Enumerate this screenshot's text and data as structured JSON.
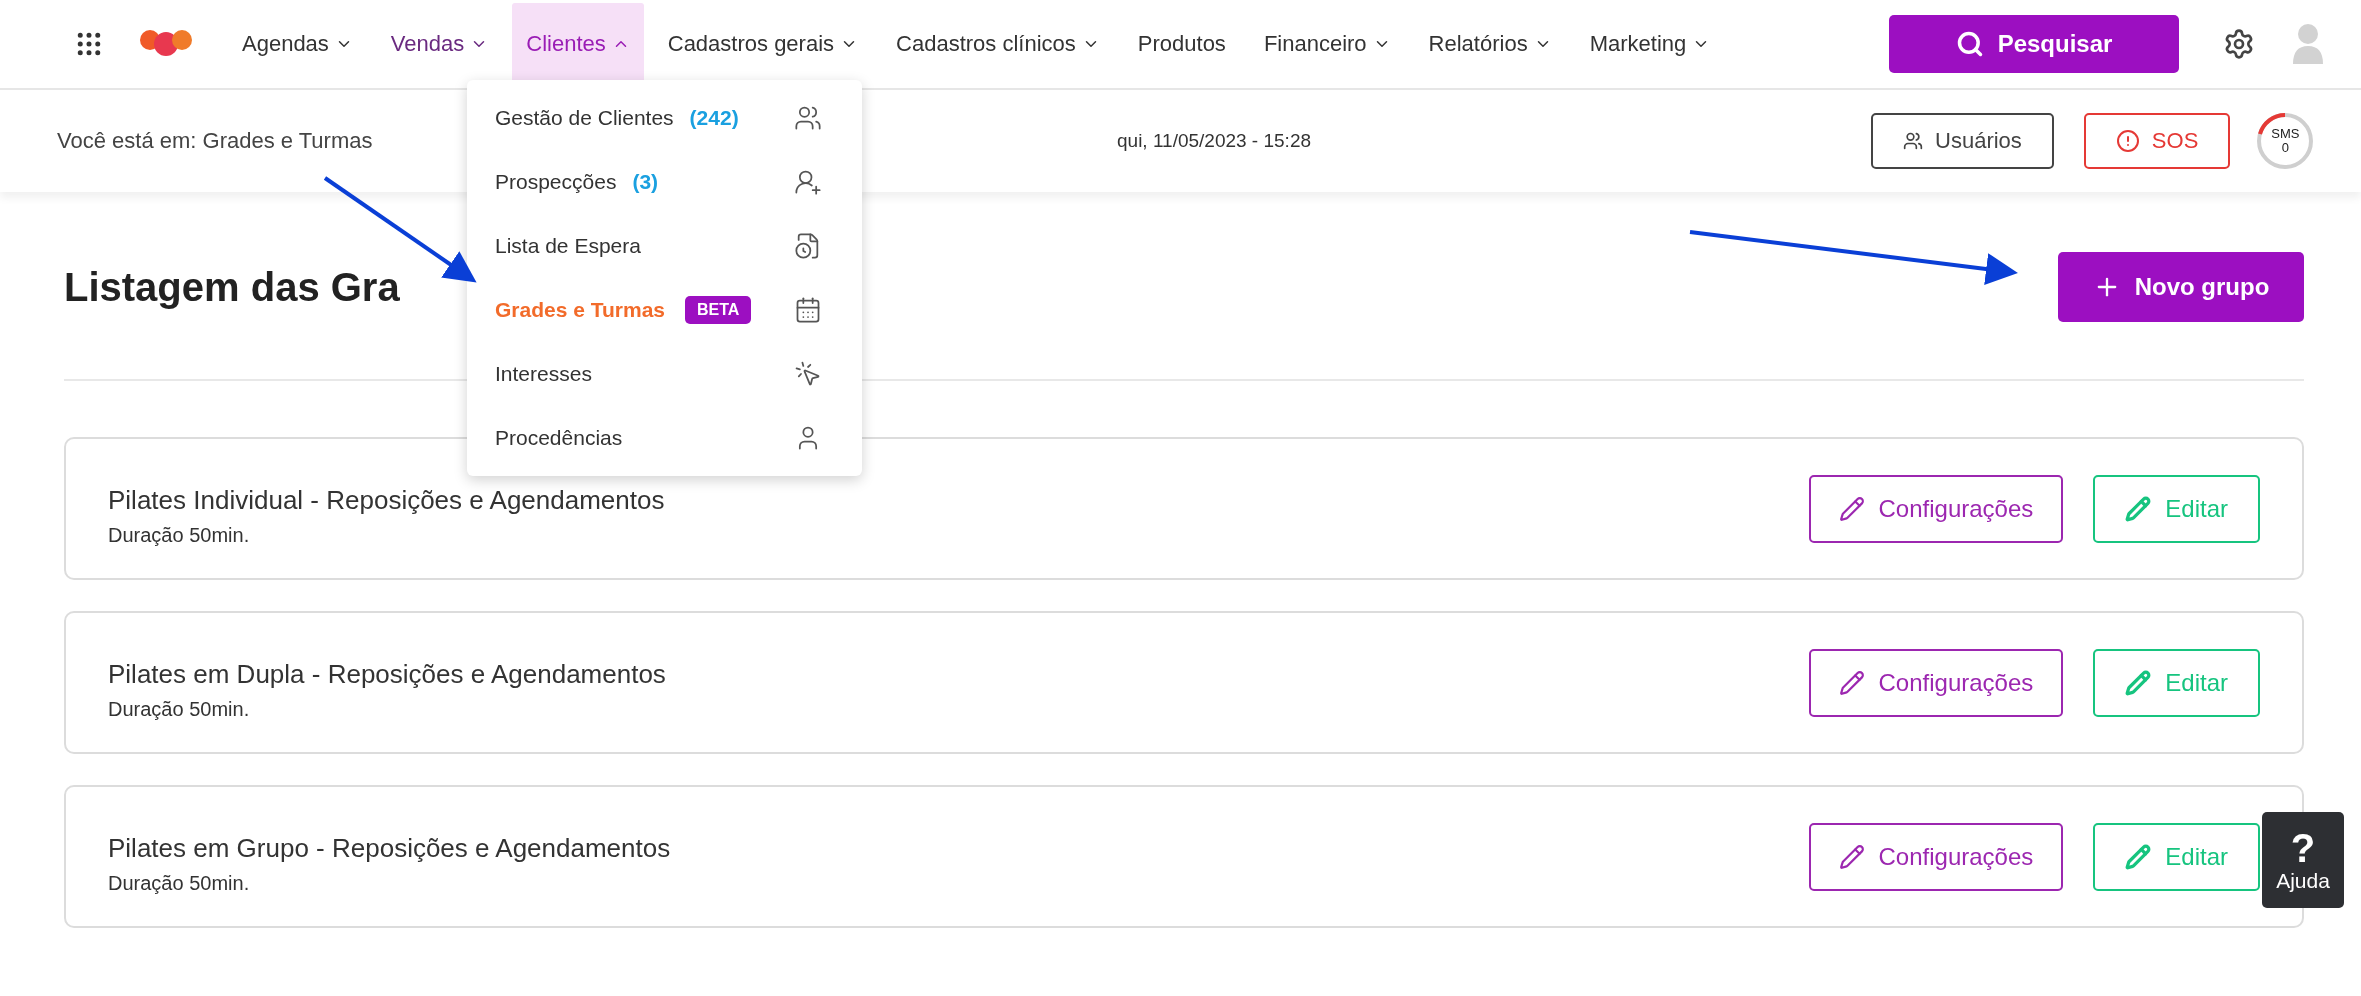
{
  "nav": {
    "items": [
      {
        "label": "Agendas",
        "has_menu": true,
        "accent": false,
        "selected": false
      },
      {
        "label": "Vendas",
        "has_menu": true,
        "accent": true,
        "selected": false
      },
      {
        "label": "Clientes",
        "has_menu": true,
        "accent": true,
        "selected": true
      },
      {
        "label": "Cadastros gerais",
        "has_menu": true,
        "accent": false,
        "selected": false
      },
      {
        "label": "Cadastros clínicos",
        "has_menu": true,
        "accent": false,
        "selected": false
      },
      {
        "label": "Produtos",
        "has_menu": false,
        "accent": false,
        "selected": false
      },
      {
        "label": "Financeiro",
        "has_menu": true,
        "accent": false,
        "selected": false
      },
      {
        "label": "Relatórios",
        "has_menu": true,
        "accent": false,
        "selected": false
      },
      {
        "label": "Marketing",
        "has_menu": true,
        "accent": false,
        "selected": false
      }
    ]
  },
  "search_button": "Pesquisar",
  "breadcrumb": "Você está em: Grades e Turmas",
  "datetime": "qui, 11/05/2023 - 15:28",
  "users_button": "Usuários",
  "sos_button": "SOS",
  "sms": {
    "label": "SMS",
    "count": "0"
  },
  "menu": {
    "items": [
      {
        "label": "Gestão de Clientes",
        "count": "(242)",
        "selected": false
      },
      {
        "label": "Prospecções",
        "count": "(3)",
        "selected": false
      },
      {
        "label": "Lista de Espera",
        "selected": false
      },
      {
        "label": "Grades e Turmas",
        "badge": "BETA",
        "selected": true
      },
      {
        "label": "Interesses",
        "selected": false
      },
      {
        "label": "Procedências",
        "selected": false
      }
    ]
  },
  "page": {
    "title": "Listagem das Gra",
    "new_button": "Novo grupo"
  },
  "groups": [
    {
      "name": "Pilates Individual - Reposições e Agendamentos",
      "duration": "Duração 50min.",
      "settings_button": "Configurações",
      "edit_button": "Editar"
    },
    {
      "name": "Pilates em Dupla - Reposições e Agendamentos",
      "duration": "Duração 50min.",
      "settings_button": "Configurações",
      "edit_button": "Editar"
    },
    {
      "name": "Pilates em Grupo - Reposições e Agendamentos",
      "duration": "Duração 50min.",
      "settings_button": "Configurações",
      "edit_button": "Editar"
    }
  ],
  "help": {
    "mark": "?",
    "label": "Ajuda"
  }
}
